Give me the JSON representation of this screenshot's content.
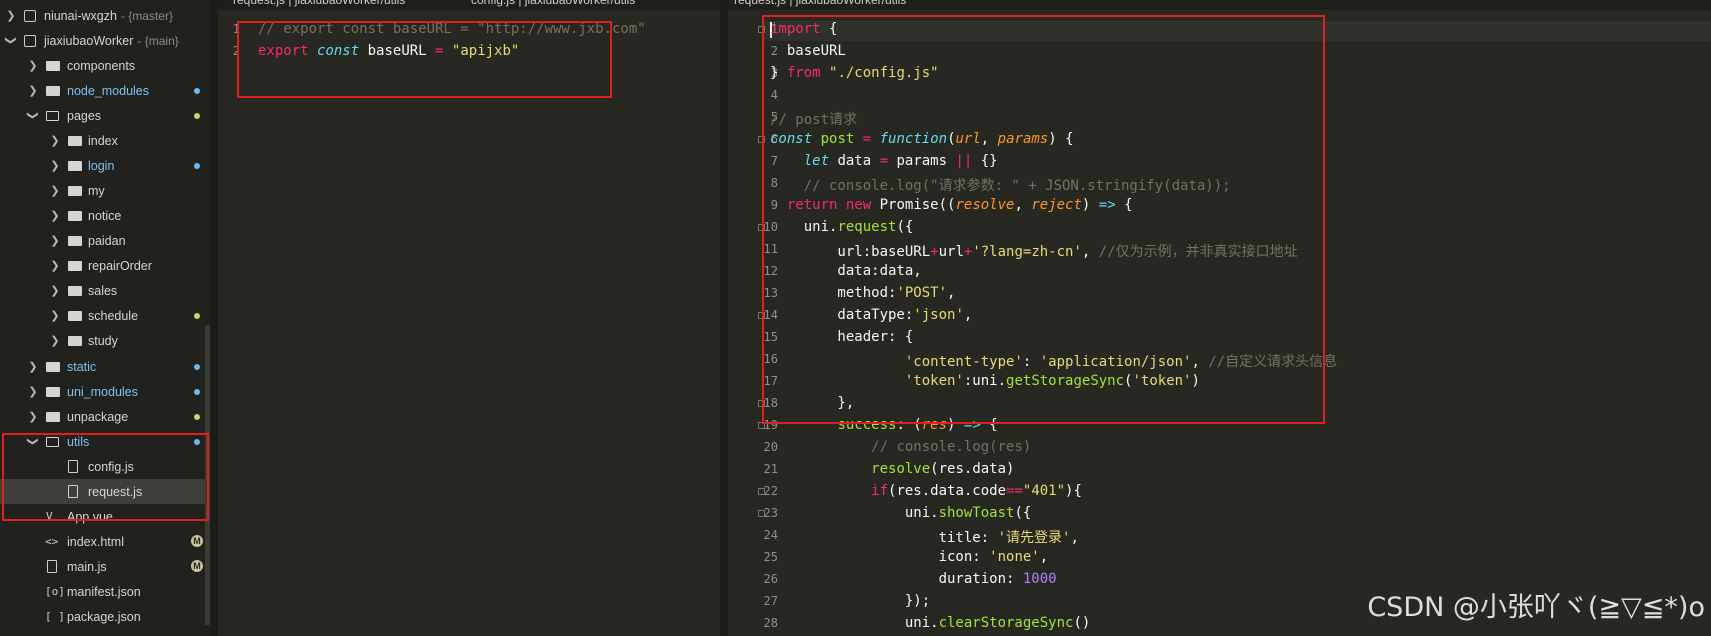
{
  "explorer": {
    "rows": [
      {
        "label": "niunai-wxgzh",
        "branch": "- {master}"
      },
      {
        "label": "jiaxiubaoWorker",
        "branch": "- {main}"
      },
      {
        "label": "components"
      },
      {
        "label": "node_modules"
      },
      {
        "label": "pages"
      },
      {
        "label": "index"
      },
      {
        "label": "login"
      },
      {
        "label": "my"
      },
      {
        "label": "notice"
      },
      {
        "label": "paidan"
      },
      {
        "label": "repairOrder"
      },
      {
        "label": "sales"
      },
      {
        "label": "schedule"
      },
      {
        "label": "study"
      },
      {
        "label": "static"
      },
      {
        "label": "uni_modules"
      },
      {
        "label": "unpackage"
      },
      {
        "label": "utils"
      },
      {
        "label": "config.js"
      },
      {
        "label": "request.js"
      },
      {
        "label": "App.vue"
      },
      {
        "label": "index.html",
        "badge": "M"
      },
      {
        "label": "main.js",
        "badge": "M"
      },
      {
        "label": "manifest.json"
      },
      {
        "label": "package.json"
      }
    ]
  },
  "tabs": {
    "left_1": "request.js | jiaxiubaoWorker/utils",
    "left_2": "config.js | jiaxiubaoWorker/utils",
    "right_1": "request.js | jiaxiubaoWorker/utils"
  },
  "config_editor": {
    "line_numbers": [
      "1",
      "2"
    ],
    "line1": "// export const baseURL = \"http://www.jxb.com\"",
    "line2_kw": "export",
    "line2_const": "const",
    "line2_name": " baseURL ",
    "line2_eq": "=",
    "line2_val": "\"apijxb\""
  },
  "request_editor": {
    "line_numbers": [
      "1",
      "2",
      "3",
      "4",
      "5",
      "6",
      "7",
      "8",
      "9",
      "10",
      "11",
      "12",
      "13",
      "14",
      "15",
      "16",
      "17",
      "18",
      "19",
      "20",
      "21",
      "22",
      "23",
      "24",
      "25",
      "26",
      "27",
      "28"
    ]
  },
  "watermark": "CSDN @小张吖ヾ(≧▽≦*)o",
  "colors": {
    "annotation_box": "#e02020",
    "bg": "#272822",
    "keyword": "#f92672",
    "string": "#e6db74",
    "comment": "#75715e"
  }
}
